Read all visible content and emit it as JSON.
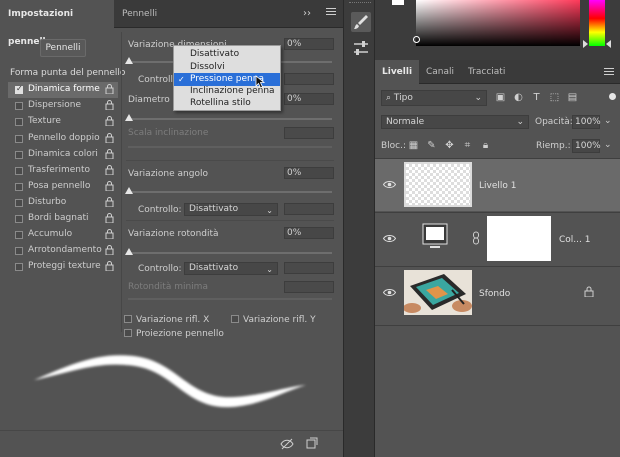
{
  "left_panel": {
    "tabs": [
      {
        "label": "Impostazioni pennello"
      },
      {
        "label": "Pennelli"
      }
    ],
    "panel_arrows": "››",
    "pennelli_button": "Pennelli",
    "section_title": "Forma punta del pennello",
    "options": [
      {
        "label": "Dinamica forme",
        "checked": true
      },
      {
        "label": "Dispersione",
        "checked": false
      },
      {
        "label": "Texture",
        "checked": false
      },
      {
        "label": "Pennello doppio",
        "checked": false
      },
      {
        "label": "Dinamica colori",
        "checked": false
      },
      {
        "label": "Trasferimento",
        "checked": false
      },
      {
        "label": "Posa pennello",
        "checked": false
      },
      {
        "label": "Disturbo",
        "checked": false
      },
      {
        "label": "Bordi bagnati",
        "checked": false
      },
      {
        "label": "Accumulo",
        "checked": false
      },
      {
        "label": "Arrotondamento",
        "checked": false
      },
      {
        "label": "Proteggi texture",
        "checked": false
      }
    ],
    "controls": {
      "variazione_dimensioni": {
        "label": "Variazione dimensioni",
        "value": "0%",
        "control_label": "Controllo:"
      },
      "diametro_minimo": {
        "label": "Diametro minimo",
        "value": "0%"
      },
      "scala_inclinazione": {
        "label": "Scala inclinazione"
      },
      "variazione_angolo": {
        "label": "Variazione angolo",
        "value": "0%",
        "control_label": "Controllo:",
        "control_value": "Disattivato"
      },
      "variazione_rotondita": {
        "label": "Variazione rotondità",
        "value": "0%",
        "control_label": "Controllo:",
        "control_value": "Disattivato"
      },
      "rotondita_minima": {
        "label": "Rotondità minima"
      }
    },
    "checkboxes": {
      "rifl_x": "Variazione rifl. X",
      "rifl_y": "Variazione rifl. Y",
      "proiezione": "Proiezione pennello"
    },
    "dropdown": {
      "items": [
        {
          "label": "Disattivato",
          "selected": false
        },
        {
          "label": "Dissolvi",
          "selected": false
        },
        {
          "label": "Pressione penna",
          "selected": true
        },
        {
          "label": "Inclinazione penna",
          "selected": false
        },
        {
          "label": "Rotellina stilo",
          "selected": false
        }
      ]
    }
  },
  "right_panel": {
    "tabs": [
      {
        "label": "Livelli"
      },
      {
        "label": "Canali"
      },
      {
        "label": "Tracciati"
      }
    ],
    "filter": {
      "value": "Tipo",
      "icon": "search-icon"
    },
    "blend_mode": "Normale",
    "opacity": {
      "label": "Opacità:",
      "value": "100%"
    },
    "lock": {
      "label": "Bloc.:"
    },
    "fill": {
      "label": "Riemp.:",
      "value": "100%"
    },
    "layers": [
      {
        "name": "Livello 1",
        "selected": true
      },
      {
        "name": "Col... 1",
        "selected": false
      },
      {
        "name": "Sfondo",
        "selected": false,
        "locked": true
      }
    ]
  },
  "colors": {
    "panel_bg": "#535353",
    "tab_bg": "#3a3a3a",
    "selection_blue": "#2a6fd8"
  }
}
